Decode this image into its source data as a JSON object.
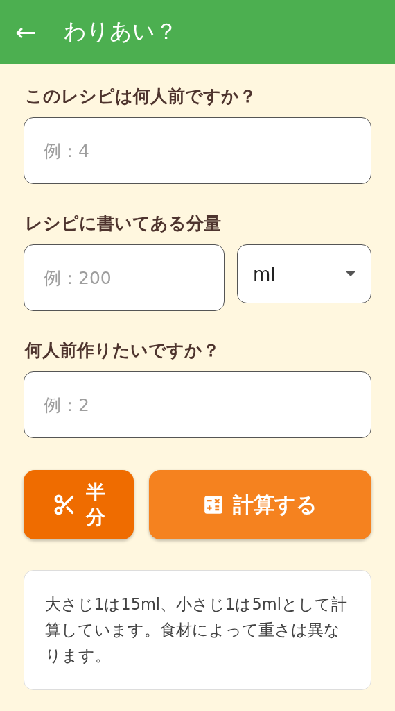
{
  "app_bar": {
    "back": "←",
    "title": "わりあい？"
  },
  "servings": {
    "label": "このレシピは何人前ですか？",
    "placeholder": "例：4"
  },
  "amount": {
    "label": "レシピに書いてある分量",
    "placeholder": "例：200",
    "unit": "ml"
  },
  "target": {
    "label": "何人前作りたいですか？",
    "placeholder": "例：2"
  },
  "buttons": [
    {
      "kind": "half",
      "label": "半分"
    },
    {
      "kind": "calculate",
      "label": "計算する"
    }
  ],
  "note": "大さじ1は15ml、小さじ1は5mlとして計算しています。食材によって重さは異なります。"
}
